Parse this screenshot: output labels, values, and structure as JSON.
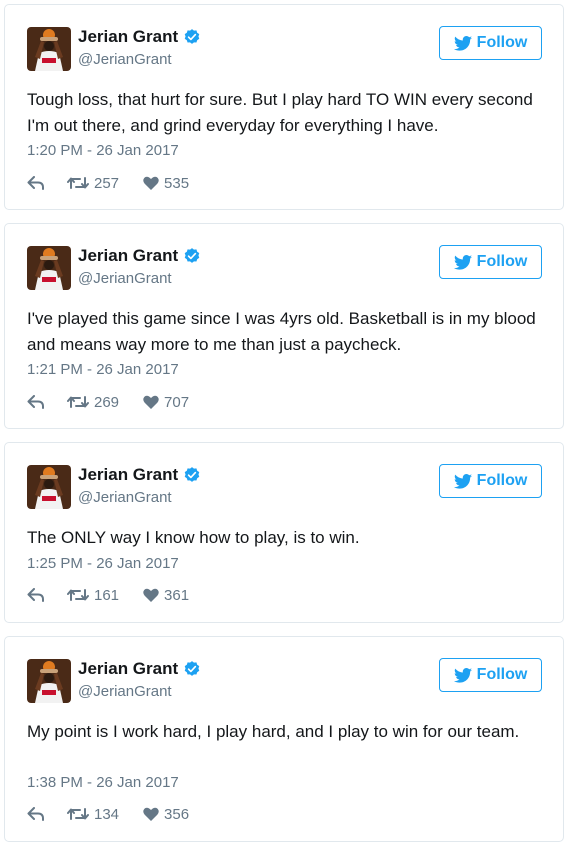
{
  "theme": {
    "accent": "#1da1f2",
    "text": "#14171a",
    "muted": "#657786",
    "border": "#e1e8ed"
  },
  "icons": {
    "verified": "verified-badge-icon",
    "bird": "twitter-bird-icon",
    "reply": "reply-icon",
    "retweet": "retweet-icon",
    "like": "heart-icon"
  },
  "tweets": [
    {
      "name": "Jerian Grant",
      "handle": "@JerianGrant",
      "follow_label": "Follow",
      "text": "Tough loss, that hurt for sure. But I play hard TO WIN every second I'm out there, and grind everyday for everything I have.",
      "timestamp": "1:20 PM - 26 Jan 2017",
      "retweets": "257",
      "likes": "535"
    },
    {
      "name": "Jerian Grant",
      "handle": "@JerianGrant",
      "follow_label": "Follow",
      "text": "I've played this game since I was 4yrs old. Basketball is in my blood and means way more to me than just a paycheck.",
      "timestamp": "1:21 PM - 26 Jan 2017",
      "retweets": "269",
      "likes": "707"
    },
    {
      "name": "Jerian Grant",
      "handle": "@JerianGrant",
      "follow_label": "Follow",
      "text": "The ONLY way I know how to play, is to win.",
      "timestamp": "1:25 PM - 26 Jan 2017",
      "retweets": "161",
      "likes": "361"
    },
    {
      "name": "Jerian Grant",
      "handle": "@JerianGrant",
      "follow_label": "Follow",
      "text": "My point is I work hard, I play hard, and I play to win for our team.",
      "timestamp": "1:38 PM - 26 Jan 2017",
      "retweets": "134",
      "likes": "356"
    }
  ]
}
